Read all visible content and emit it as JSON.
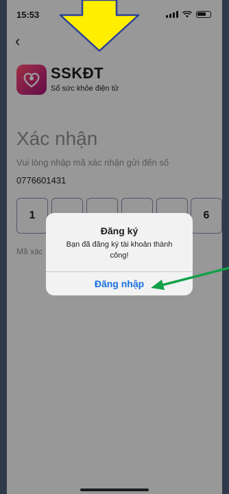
{
  "status_bar": {
    "time": "15:53"
  },
  "app": {
    "name": "SSKĐT",
    "subtitle": "Sổ sức khỏe điện tử"
  },
  "page": {
    "title": "Xác nhận",
    "instruction": "Vui lòng nhập mã xác nhận gửi đến số",
    "phone_number": "0776601431",
    "code_digits": [
      "1",
      "",
      "",
      "",
      "",
      "6"
    ],
    "hint_prefix": "Mã xác"
  },
  "alert": {
    "title": "Đăng ký",
    "message": "Bạn đã đăng ký tài khoản thành công!",
    "button_label": "Đăng nhập"
  },
  "colors": {
    "accent": "#1a6fe0",
    "annotation_arrow_down": "#ffee00",
    "annotation_arrow_side": "#13a14a"
  }
}
